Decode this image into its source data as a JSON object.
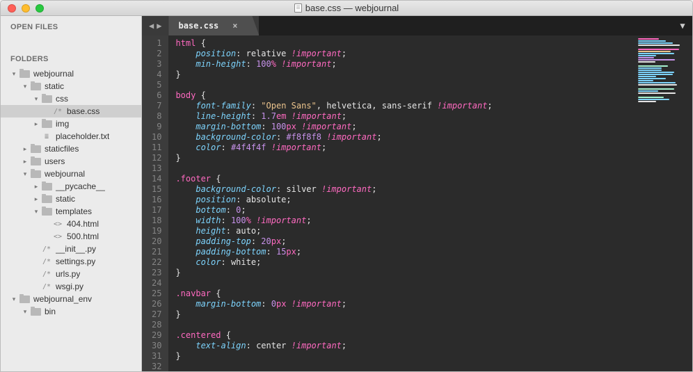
{
  "window": {
    "title": "base.css — webjournal"
  },
  "sidebar": {
    "open_files_header": "OPEN FILES",
    "folders_header": "FOLDERS",
    "tree": [
      {
        "depth": 0,
        "arrow": "▾",
        "icon": "folder",
        "label": "webjournal"
      },
      {
        "depth": 1,
        "arrow": "▾",
        "icon": "folder",
        "label": "static"
      },
      {
        "depth": 2,
        "arrow": "▾",
        "icon": "folder",
        "label": "css"
      },
      {
        "depth": 3,
        "arrow": "",
        "icon": "file",
        "label": "base.css",
        "ftype": "/*",
        "selected": true
      },
      {
        "depth": 2,
        "arrow": "▸",
        "icon": "folder",
        "label": "img"
      },
      {
        "depth": 2,
        "arrow": "",
        "icon": "file",
        "label": "placeholder.txt",
        "ftype": "≣"
      },
      {
        "depth": 1,
        "arrow": "▸",
        "icon": "folder",
        "label": "staticfiles"
      },
      {
        "depth": 1,
        "arrow": "▸",
        "icon": "folder",
        "label": "users"
      },
      {
        "depth": 1,
        "arrow": "▾",
        "icon": "folder",
        "label": "webjournal"
      },
      {
        "depth": 2,
        "arrow": "▸",
        "icon": "folder",
        "label": "__pycache__"
      },
      {
        "depth": 2,
        "arrow": "▸",
        "icon": "folder",
        "label": "static"
      },
      {
        "depth": 2,
        "arrow": "▾",
        "icon": "folder",
        "label": "templates"
      },
      {
        "depth": 3,
        "arrow": "",
        "icon": "file",
        "label": "404.html",
        "ftype": "<>"
      },
      {
        "depth": 3,
        "arrow": "",
        "icon": "file",
        "label": "500.html",
        "ftype": "<>"
      },
      {
        "depth": 2,
        "arrow": "",
        "icon": "file",
        "label": "__init__.py",
        "ftype": "/*"
      },
      {
        "depth": 2,
        "arrow": "",
        "icon": "file",
        "label": "settings.py",
        "ftype": "/*"
      },
      {
        "depth": 2,
        "arrow": "",
        "icon": "file",
        "label": "urls.py",
        "ftype": "/*"
      },
      {
        "depth": 2,
        "arrow": "",
        "icon": "file",
        "label": "wsgi.py",
        "ftype": "/*"
      },
      {
        "depth": 0,
        "arrow": "▾",
        "icon": "folder",
        "label": "webjournal_env"
      },
      {
        "depth": 1,
        "arrow": "▾",
        "icon": "folder",
        "label": "bin"
      }
    ]
  },
  "tabs": {
    "active": "base.css",
    "close": "×",
    "menu": "▼"
  },
  "nav": {
    "back": "◀",
    "forward": "▶"
  },
  "code": {
    "lines": [
      [
        {
          "t": "html ",
          "c": "sel"
        },
        {
          "t": "{",
          "c": "brace"
        }
      ],
      [
        {
          "t": "    ",
          "c": ""
        },
        {
          "t": "position",
          "c": "prop"
        },
        {
          "t": ": ",
          "c": "punct"
        },
        {
          "t": "relative ",
          "c": "val"
        },
        {
          "t": "!important",
          "c": "imp"
        },
        {
          "t": ";",
          "c": "punct"
        }
      ],
      [
        {
          "t": "    ",
          "c": ""
        },
        {
          "t": "min-height",
          "c": "prop"
        },
        {
          "t": ": ",
          "c": "punct"
        },
        {
          "t": "100",
          "c": "num"
        },
        {
          "t": "% ",
          "c": "unit"
        },
        {
          "t": "!important",
          "c": "imp"
        },
        {
          "t": ";",
          "c": "punct"
        }
      ],
      [
        {
          "t": "}",
          "c": "brace"
        }
      ],
      [
        {
          "t": "",
          "c": ""
        }
      ],
      [
        {
          "t": "body ",
          "c": "sel"
        },
        {
          "t": "{",
          "c": "brace"
        }
      ],
      [
        {
          "t": "    ",
          "c": ""
        },
        {
          "t": "font-family",
          "c": "prop"
        },
        {
          "t": ": ",
          "c": "punct"
        },
        {
          "t": "\"Open Sans\"",
          "c": "str"
        },
        {
          "t": ", helvetica, sans-serif ",
          "c": "val"
        },
        {
          "t": "!important",
          "c": "imp"
        },
        {
          "t": ";",
          "c": "punct"
        }
      ],
      [
        {
          "t": "    ",
          "c": ""
        },
        {
          "t": "line-height",
          "c": "prop"
        },
        {
          "t": ": ",
          "c": "punct"
        },
        {
          "t": "1.7",
          "c": "num"
        },
        {
          "t": "em ",
          "c": "unit"
        },
        {
          "t": "!important",
          "c": "imp"
        },
        {
          "t": ";",
          "c": "punct"
        }
      ],
      [
        {
          "t": "    ",
          "c": ""
        },
        {
          "t": "margin-bottom",
          "c": "prop"
        },
        {
          "t": ": ",
          "c": "punct"
        },
        {
          "t": "100",
          "c": "num"
        },
        {
          "t": "px ",
          "c": "unit"
        },
        {
          "t": "!important",
          "c": "imp"
        },
        {
          "t": ";",
          "c": "punct"
        }
      ],
      [
        {
          "t": "    ",
          "c": ""
        },
        {
          "t": "background-color",
          "c": "prop"
        },
        {
          "t": ": ",
          "c": "punct"
        },
        {
          "t": "#f8f8f8 ",
          "c": "num"
        },
        {
          "t": "!important",
          "c": "imp"
        },
        {
          "t": ";",
          "c": "punct"
        }
      ],
      [
        {
          "t": "    ",
          "c": ""
        },
        {
          "t": "color",
          "c": "prop"
        },
        {
          "t": ": ",
          "c": "punct"
        },
        {
          "t": "#4f4f4f ",
          "c": "num"
        },
        {
          "t": "!important",
          "c": "imp"
        },
        {
          "t": ";",
          "c": "punct"
        }
      ],
      [
        {
          "t": "}",
          "c": "brace"
        }
      ],
      [
        {
          "t": "",
          "c": ""
        }
      ],
      [
        {
          "t": ".footer ",
          "c": "sel"
        },
        {
          "t": "{",
          "c": "brace"
        }
      ],
      [
        {
          "t": "    ",
          "c": ""
        },
        {
          "t": "background-color",
          "c": "prop"
        },
        {
          "t": ": ",
          "c": "punct"
        },
        {
          "t": "silver ",
          "c": "val"
        },
        {
          "t": "!important",
          "c": "imp"
        },
        {
          "t": ";",
          "c": "punct"
        }
      ],
      [
        {
          "t": "    ",
          "c": ""
        },
        {
          "t": "position",
          "c": "prop"
        },
        {
          "t": ": ",
          "c": "punct"
        },
        {
          "t": "absolute",
          "c": "val"
        },
        {
          "t": ";",
          "c": "punct"
        }
      ],
      [
        {
          "t": "    ",
          "c": ""
        },
        {
          "t": "bottom",
          "c": "prop"
        },
        {
          "t": ": ",
          "c": "punct"
        },
        {
          "t": "0",
          "c": "num"
        },
        {
          "t": ";",
          "c": "punct"
        }
      ],
      [
        {
          "t": "    ",
          "c": ""
        },
        {
          "t": "width",
          "c": "prop"
        },
        {
          "t": ": ",
          "c": "punct"
        },
        {
          "t": "100",
          "c": "num"
        },
        {
          "t": "% ",
          "c": "unit"
        },
        {
          "t": "!important",
          "c": "imp"
        },
        {
          "t": ";",
          "c": "punct"
        }
      ],
      [
        {
          "t": "    ",
          "c": ""
        },
        {
          "t": "height",
          "c": "prop"
        },
        {
          "t": ": ",
          "c": "punct"
        },
        {
          "t": "auto",
          "c": "val"
        },
        {
          "t": ";",
          "c": "punct"
        }
      ],
      [
        {
          "t": "    ",
          "c": ""
        },
        {
          "t": "padding-top",
          "c": "prop"
        },
        {
          "t": ": ",
          "c": "punct"
        },
        {
          "t": "20",
          "c": "num"
        },
        {
          "t": "px",
          "c": "unit"
        },
        {
          "t": ";",
          "c": "punct"
        }
      ],
      [
        {
          "t": "    ",
          "c": ""
        },
        {
          "t": "padding-bottom",
          "c": "prop"
        },
        {
          "t": ": ",
          "c": "punct"
        },
        {
          "t": "15",
          "c": "num"
        },
        {
          "t": "px",
          "c": "unit"
        },
        {
          "t": ";",
          "c": "punct"
        }
      ],
      [
        {
          "t": "    ",
          "c": ""
        },
        {
          "t": "color",
          "c": "prop"
        },
        {
          "t": ": ",
          "c": "punct"
        },
        {
          "t": "white",
          "c": "val"
        },
        {
          "t": ";",
          "c": "punct"
        }
      ],
      [
        {
          "t": "}",
          "c": "brace"
        }
      ],
      [
        {
          "t": "",
          "c": ""
        }
      ],
      [
        {
          "t": ".navbar ",
          "c": "sel"
        },
        {
          "t": "{",
          "c": "brace"
        }
      ],
      [
        {
          "t": "    ",
          "c": ""
        },
        {
          "t": "margin-bottom",
          "c": "prop"
        },
        {
          "t": ": ",
          "c": "punct"
        },
        {
          "t": "0",
          "c": "num"
        },
        {
          "t": "px ",
          "c": "unit"
        },
        {
          "t": "!important",
          "c": "imp"
        },
        {
          "t": ";",
          "c": "punct"
        }
      ],
      [
        {
          "t": "}",
          "c": "brace"
        }
      ],
      [
        {
          "t": "",
          "c": ""
        }
      ],
      [
        {
          "t": ".centered ",
          "c": "sel"
        },
        {
          "t": "{",
          "c": "brace"
        }
      ],
      [
        {
          "t": "    ",
          "c": ""
        },
        {
          "t": "text-align",
          "c": "prop"
        },
        {
          "t": ": ",
          "c": "punct"
        },
        {
          "t": "center ",
          "c": "val"
        },
        {
          "t": "!important",
          "c": "imp"
        },
        {
          "t": ";",
          "c": "punct"
        }
      ],
      [
        {
          "t": "}",
          "c": "brace"
        }
      ],
      [
        {
          "t": "",
          "c": ""
        }
      ]
    ]
  },
  "minimap_colors": [
    "#ff6ac1",
    "#7dd3fc",
    "#7dd3fc",
    "#e5e5e5",
    "",
    "#ff6ac1",
    "#ecc48d",
    "#7dd3fc",
    "#7dd3fc",
    "#c792ea",
    "#c792ea",
    "#e5e5e5",
    "",
    "#a7f3d0",
    "#7dd3fc",
    "#7dd3fc",
    "#7dd3fc",
    "#7dd3fc",
    "#7dd3fc",
    "#7dd3fc",
    "#7dd3fc",
    "#7dd3fc",
    "#e5e5e5",
    "",
    "#a7f3d0",
    "#7dd3fc",
    "#e5e5e5",
    "",
    "#a7f3d0",
    "#7dd3fc",
    "#e5e5e5",
    ""
  ]
}
